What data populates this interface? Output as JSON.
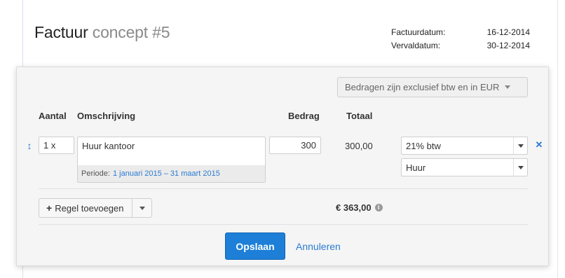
{
  "invoice": {
    "title_main": "Factuur",
    "title_sub": "concept #5",
    "dates": [
      {
        "label": "Factuurdatum:",
        "value": "16-12-2014"
      },
      {
        "label": "Vervaldatum:",
        "value": "30-12-2014"
      }
    ]
  },
  "editor": {
    "currency_note": "Bedragen zijn exclusief btw en in EUR",
    "headers": {
      "aantal": "Aantal",
      "omschrijving": "Omschrijving",
      "bedrag": "Bedrag",
      "totaal": "Totaal"
    },
    "line": {
      "quantity": "1 x",
      "description": "Huur kantoor",
      "period_label": "Periode:",
      "period_value": "1 januari 2015 – 31 maart 2015",
      "amount": "300",
      "total": "300,00",
      "vat": "21% btw",
      "ledger": "Huur"
    },
    "add_row_label": "Regel toevoegen",
    "grand_total": "€ 363,00",
    "save_label": "Opslaan",
    "cancel_label": "Annuleren"
  },
  "icons": {
    "drag": "drag-handle-icon",
    "remove": "remove-icon",
    "info": "info-icon",
    "plus": "plus-icon"
  },
  "colors": {
    "accent": "#1d7fd7",
    "link": "#2a7bd1",
    "panel_bg": "#f5f5f5"
  }
}
